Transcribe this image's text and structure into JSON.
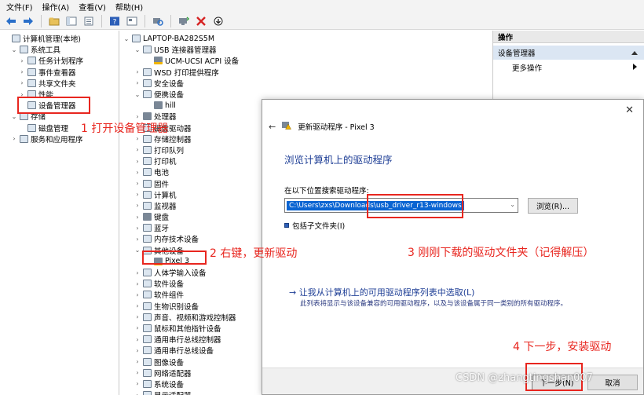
{
  "menu": [
    "文件(F)",
    "操作(A)",
    "查看(V)",
    "帮助(H)"
  ],
  "toolbar_icons": [
    "back-arrow-icon",
    "forward-arrow-icon",
    "up-folder-icon",
    "show-hide-tree-icon",
    "properties-icon",
    "help-icon",
    "view-icon",
    "scan-hardware-icon",
    "update-driver-icon",
    "uninstall-icon",
    "download-icon"
  ],
  "left_tree": [
    {
      "label": "计算机管理(本地)",
      "indent": 0,
      "twisty": "",
      "icon": "computer-icon"
    },
    {
      "label": "系统工具",
      "indent": 1,
      "twisty": "⌄",
      "icon": "tools-icon"
    },
    {
      "label": "任务计划程序",
      "indent": 2,
      "twisty": "›",
      "icon": "clock-icon"
    },
    {
      "label": "事件查看器",
      "indent": 2,
      "twisty": "›",
      "icon": "event-viewer-icon"
    },
    {
      "label": "共享文件夹",
      "indent": 2,
      "twisty": "›",
      "icon": "shared-folder-icon"
    },
    {
      "label": "性能",
      "indent": 2,
      "twisty": "›",
      "icon": "performance-icon"
    },
    {
      "label": "设备管理器",
      "indent": 2,
      "twisty": "",
      "icon": "device-manager-icon"
    },
    {
      "label": "存储",
      "indent": 1,
      "twisty": "⌄",
      "icon": "storage-icon"
    },
    {
      "label": "磁盘管理",
      "indent": 2,
      "twisty": "",
      "icon": "disk-icon"
    },
    {
      "label": "服务和应用程序",
      "indent": 1,
      "twisty": "›",
      "icon": "services-icon"
    }
  ],
  "center_tree": [
    {
      "label": "LAPTOP-BA282S5M",
      "indent": 0,
      "twisty": "⌄",
      "icon": "computer-icon"
    },
    {
      "label": "USB 连接器管理器",
      "indent": 1,
      "twisty": "⌄",
      "icon": "usb-icon"
    },
    {
      "label": "UCM-UCSI ACPI 设备",
      "indent": 2,
      "twisty": "",
      "icon": "usb-device-warning-icon"
    },
    {
      "label": "WSD 打印提供程序",
      "indent": 1,
      "twisty": "›",
      "icon": "printer-icon"
    },
    {
      "label": "安全设备",
      "indent": 1,
      "twisty": "›",
      "icon": "security-icon"
    },
    {
      "label": "便携设备",
      "indent": 1,
      "twisty": "⌄",
      "icon": "portable-device-icon"
    },
    {
      "label": "hill",
      "indent": 2,
      "twisty": "",
      "icon": "phone-icon"
    },
    {
      "label": "处理器",
      "indent": 1,
      "twisty": "›",
      "icon": "cpu-icon"
    },
    {
      "label": "磁盘驱动器",
      "indent": 1,
      "twisty": "›",
      "icon": "disk-drive-icon"
    },
    {
      "label": "存储控制器",
      "indent": 1,
      "twisty": "›",
      "icon": "storage-controller-icon"
    },
    {
      "label": "打印队列",
      "indent": 1,
      "twisty": "›",
      "icon": "print-queue-icon"
    },
    {
      "label": "打印机",
      "indent": 1,
      "twisty": "›",
      "icon": "printer-icon"
    },
    {
      "label": "电池",
      "indent": 1,
      "twisty": "›",
      "icon": "battery-icon"
    },
    {
      "label": "固件",
      "indent": 1,
      "twisty": "›",
      "icon": "firmware-icon"
    },
    {
      "label": "计算机",
      "indent": 1,
      "twisty": "›",
      "icon": "computer-icon"
    },
    {
      "label": "监视器",
      "indent": 1,
      "twisty": "›",
      "icon": "monitor-icon"
    },
    {
      "label": "键盘",
      "indent": 1,
      "twisty": "›",
      "icon": "keyboard-icon"
    },
    {
      "label": "蓝牙",
      "indent": 1,
      "twisty": "›",
      "icon": "bluetooth-icon"
    },
    {
      "label": "内存技术设备",
      "indent": 1,
      "twisty": "›",
      "icon": "memory-icon"
    },
    {
      "label": "其他设备",
      "indent": 1,
      "twisty": "⌄",
      "icon": "other-devices-icon"
    },
    {
      "label": "Pixel 3",
      "indent": 2,
      "twisty": "",
      "icon": "device-warning-icon"
    },
    {
      "label": "人体学输入设备",
      "indent": 1,
      "twisty": "›",
      "icon": "hid-icon"
    },
    {
      "label": "软件设备",
      "indent": 1,
      "twisty": "›",
      "icon": "software-device-icon"
    },
    {
      "label": "软件组件",
      "indent": 1,
      "twisty": "›",
      "icon": "software-component-icon"
    },
    {
      "label": "生物识别设备",
      "indent": 1,
      "twisty": "›",
      "icon": "biometric-icon"
    },
    {
      "label": "声音、视频和游戏控制器",
      "indent": 1,
      "twisty": "›",
      "icon": "sound-icon"
    },
    {
      "label": "鼠标和其他指针设备",
      "indent": 1,
      "twisty": "›",
      "icon": "mouse-icon"
    },
    {
      "label": "通用串行总线控制器",
      "indent": 1,
      "twisty": "›",
      "icon": "usb-icon"
    },
    {
      "label": "通用串行总线设备",
      "indent": 1,
      "twisty": "›",
      "icon": "usb-icon"
    },
    {
      "label": "图像设备",
      "indent": 1,
      "twisty": "›",
      "icon": "camera-icon"
    },
    {
      "label": "网络适配器",
      "indent": 1,
      "twisty": "›",
      "icon": "network-icon"
    },
    {
      "label": "系统设备",
      "indent": 1,
      "twisty": "›",
      "icon": "system-device-icon"
    },
    {
      "label": "显示适配器",
      "indent": 1,
      "twisty": "›",
      "icon": "display-adapter-icon"
    }
  ],
  "actions": {
    "header": "操作",
    "section": "设备管理器",
    "more": "更多操作"
  },
  "dialog": {
    "title": "更新驱动程序 - Pixel 3",
    "heading": "浏览计算机上的驱动程序",
    "search_label": "在以下位置搜索驱动程序:",
    "path_value": "C:\\Users\\zxs\\Downloads\\usb_driver_r13-windows",
    "browse_label": "浏览(R)...",
    "include_subfolders": "包括子文件夹(I)",
    "pick_link": "→ 让我从计算机上的可用驱动程序列表中选取(L)",
    "pick_desc": "此列表将显示与该设备兼容的可用驱动程序，以及与该设备属于同一类别的所有驱动程序。",
    "next_label": "下一步(N)",
    "cancel_label": "取消"
  },
  "annotations": {
    "step1": "1 打开设备管理器",
    "step2": "2 右键，更新驱动",
    "step3": "3 刚刚下载的驱动文件夹（记得解压）",
    "step4": "4 下一步，安装驱动"
  },
  "watermark": "CSDN @zhangtingshan007",
  "colors": {
    "annotation_red": "#e8261f",
    "link_blue": "#1f3f96",
    "selection_blue": "#0a64d2",
    "section_highlight": "#dbe6f3"
  }
}
